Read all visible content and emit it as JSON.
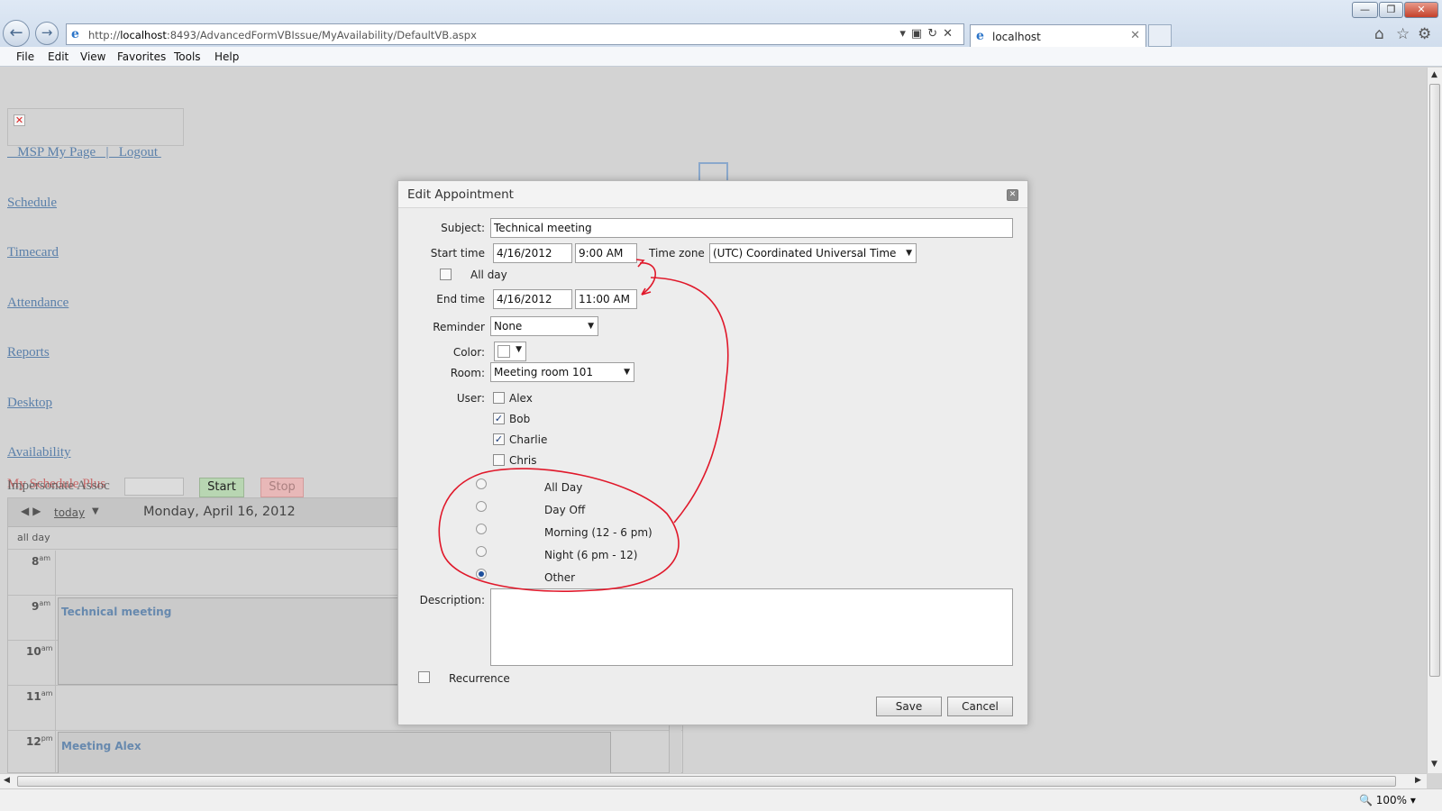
{
  "browser": {
    "url_prefix": "http://",
    "url_host": "localhost",
    "url_rest": ":8493/AdvancedFormVBIssue/MyAvailability/DefaultVB.aspx",
    "tab_title": "localhost",
    "zoom": "100%",
    "menu": [
      "File",
      "Edit",
      "View",
      "Favorites",
      "Tools",
      "Help"
    ]
  },
  "page": {
    "toplinks": "   MSP My Page   |   Logout ",
    "nav": [
      "Schedule",
      "Timecard",
      "Attendance",
      "Reports",
      "Desktop",
      "Availability"
    ],
    "overlap_red_text": "My Schedule Plus",
    "impersonate_label": "Impersonate Assoc",
    "start_label": "Start",
    "stop_label": "Stop"
  },
  "calendar": {
    "today_label": "today",
    "date_title": "Monday, April 16, 2012",
    "allday_label": "all day",
    "hours": [
      {
        "h": "8",
        "ap": "am"
      },
      {
        "h": "9",
        "ap": "am"
      },
      {
        "h": "10",
        "ap": "am"
      },
      {
        "h": "11",
        "ap": "am"
      },
      {
        "h": "12",
        "ap": "pm"
      }
    ],
    "appointments": [
      "Technical meeting",
      "Meeting Alex"
    ]
  },
  "dialog": {
    "title": "Edit Appointment",
    "subject_label": "Subject:",
    "subject_value": "Technical meeting",
    "start_label": "Start time",
    "start_date": "4/16/2012",
    "start_time": "9:00 AM",
    "timezone_label": "Time zone",
    "timezone_value": "(UTC) Coordinated Universal Time",
    "allday_label": "All day",
    "end_label": "End time",
    "end_date": "4/16/2012",
    "end_time": "11:00 AM",
    "reminder_label": "Reminder",
    "reminder_value": "None",
    "color_label": "Color:",
    "room_label": "Room:",
    "room_value": "Meeting room 101",
    "user_label": "User:",
    "users": [
      {
        "name": "Alex",
        "checked": false
      },
      {
        "name": "Bob",
        "checked": true
      },
      {
        "name": "Charlie",
        "checked": true
      },
      {
        "name": "Chris",
        "checked": false
      }
    ],
    "availability_options": [
      {
        "label": "All Day",
        "selected": false
      },
      {
        "label": "Day Off",
        "selected": false
      },
      {
        "label": "Morning (12 - 6 pm)",
        "selected": false
      },
      {
        "label": "Night (6 pm - 12)",
        "selected": false
      },
      {
        "label": "Other",
        "selected": true
      }
    ],
    "description_label": "Description:",
    "recurrence_label": "Recurrence",
    "save_label": "Save",
    "cancel_label": "Cancel"
  },
  "colors": {
    "annotation": "#e0182a",
    "link": "#5b80aa",
    "start_button": "#b8d6b2",
    "stop_button": "#e8b8b8"
  }
}
